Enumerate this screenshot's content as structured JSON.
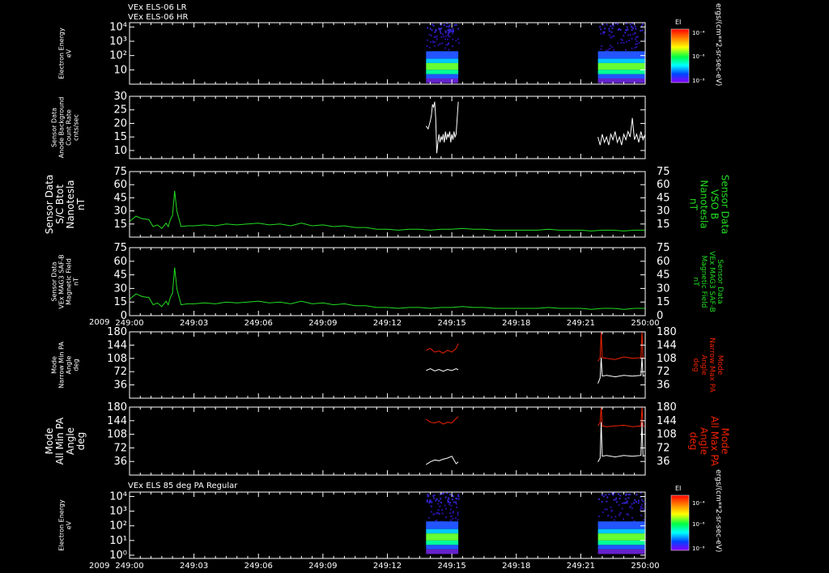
{
  "header": {
    "line1": "VEx ELS-06 LR",
    "line2": "VEx ELS-06 HR",
    "panel7_title": "VEx ELS 85 deg PA Regular"
  },
  "colors": {
    "background": "#000000",
    "axis": "#ffffff",
    "white_trace": "#ffffff",
    "green_trace": "#22dd22",
    "red_trace": "#ee2200",
    "green_label": "#22dd22",
    "red_label": "#ee2200"
  },
  "xaxis": {
    "year": "2009",
    "ticks": [
      "249:00",
      "249:03",
      "249:06",
      "249:09",
      "249:12",
      "249:15",
      "249:18",
      "249:21",
      "250:00"
    ],
    "range_hours": [
      0,
      24
    ]
  },
  "colorbar": {
    "title": "EI",
    "units": "ergs/(cm**2-sr-sec-eV)",
    "tick_labels": [
      "10⁻⁴",
      "10⁻⁶",
      "10⁻⁸"
    ]
  },
  "chart_data": [
    {
      "type": "heatmap",
      "panel": 1,
      "ylabel": [
        "Electron Energy",
        "eV"
      ],
      "yscale": "log",
      "yticks": [
        {
          "label": "10⁴",
          "value": 10000
        },
        {
          "label": "10³",
          "value": 1000
        },
        {
          "label": "10²",
          "value": 100
        },
        {
          "label": "10",
          "value": 10
        }
      ],
      "ylim": [
        1,
        20000
      ],
      "intervals_hours": [
        [
          13.8,
          15.3
        ],
        [
          21.8,
          24.0
        ]
      ]
    },
    {
      "type": "line",
      "panel": 2,
      "ylabel": [
        "Sensor Data",
        "Anode Background",
        "Count Rate",
        "cnts/sec"
      ],
      "ylim": [
        7,
        30
      ],
      "yticks": [
        10,
        15,
        20,
        25,
        30
      ],
      "series": [
        {
          "color": "#ffffff",
          "x": [
            13.8,
            13.9,
            14.0,
            14.05,
            14.1,
            14.15,
            14.2,
            14.25,
            14.3,
            14.35,
            14.4,
            14.45,
            14.5,
            14.55,
            14.6,
            14.65,
            14.7,
            14.75,
            14.8,
            14.85,
            14.9,
            14.95,
            15.0,
            15.05,
            15.1,
            15.15,
            15.2,
            15.3
          ],
          "y": [
            19,
            18,
            21,
            23,
            27,
            26,
            28,
            22,
            9,
            13,
            16,
            13,
            15,
            14,
            16,
            13,
            17,
            14,
            16,
            15,
            17,
            13,
            16,
            14,
            17,
            15,
            16,
            28
          ]
        },
        {
          "color": "#ffffff",
          "x": [
            21.8,
            21.9,
            22.0,
            22.1,
            22.2,
            22.3,
            22.4,
            22.5,
            22.6,
            22.7,
            22.8,
            22.9,
            23.0,
            23.1,
            23.2,
            23.3,
            23.4,
            23.5,
            23.6,
            23.7,
            23.8,
            23.9,
            24.0
          ],
          "y": [
            15,
            12,
            16,
            13,
            15,
            12,
            16,
            14,
            17,
            13,
            15,
            12,
            16,
            14,
            17,
            15,
            22,
            14,
            16,
            13,
            17,
            14,
            16
          ]
        }
      ]
    },
    {
      "type": "line",
      "panel": 3,
      "ylabel": [
        "Sensor Data",
        "S/C Btot",
        "Nanotesla",
        "nT"
      ],
      "ylabel_right": [
        "Sensor Data",
        "VSO B",
        "Nanotesla",
        "nT"
      ],
      "ylim": [
        0,
        75
      ],
      "yticks": [
        15,
        30,
        45,
        60,
        75
      ],
      "series": [
        {
          "color": "#22dd22",
          "x": [
            0,
            0.3,
            0.6,
            0.9,
            1.1,
            1.3,
            1.5,
            1.7,
            1.8,
            1.9,
            2.0,
            2.1,
            2.2,
            2.4,
            2.7,
            3.0,
            3.5,
            4.0,
            4.5,
            5.0,
            5.5,
            6.0,
            6.5,
            7.0,
            7.5,
            8.0,
            8.5,
            9.0,
            9.5,
            10.0,
            10.5,
            11.0,
            11.5,
            12.0,
            12.5,
            13.0,
            13.5,
            14.0,
            14.5,
            15.0,
            15.5,
            16.0,
            16.5,
            17.0,
            17.5,
            18.0,
            18.5,
            19.0,
            19.5,
            20.0,
            20.5,
            21.0,
            21.5,
            22.0,
            22.5,
            23.0,
            23.5,
            24.0
          ],
          "y": [
            18,
            24,
            21,
            20,
            12,
            14,
            10,
            16,
            12,
            20,
            25,
            53,
            30,
            12,
            13,
            13,
            14,
            13,
            15,
            14,
            15,
            16,
            14,
            15,
            13,
            16,
            13,
            14,
            12,
            13,
            11,
            11,
            9,
            9,
            8,
            9,
            9,
            8,
            9,
            9,
            10,
            9,
            9,
            8,
            8,
            8,
            8,
            8,
            9,
            8,
            8,
            8,
            7,
            8,
            8,
            7,
            8,
            8
          ]
        }
      ]
    },
    {
      "type": "line",
      "panel": 4,
      "ylabel": [
        "Sensor Data",
        "VEx MAG3 SAF-B",
        "Magnetic Field",
        "nT"
      ],
      "ylabel_right": [
        "Sensor Data",
        "VEx MAG3 SAF-B",
        "Magnetic Field",
        "nT"
      ],
      "ylim": [
        0,
        75
      ],
      "yticks": [
        0,
        15,
        30,
        45,
        60,
        75
      ],
      "series": [
        {
          "color": "#22dd22",
          "x": [
            0,
            0.3,
            0.6,
            0.9,
            1.1,
            1.3,
            1.5,
            1.7,
            1.8,
            1.9,
            2.0,
            2.1,
            2.2,
            2.4,
            2.7,
            3.0,
            3.5,
            4.0,
            4.5,
            5.0,
            5.5,
            6.0,
            6.5,
            7.0,
            7.5,
            8.0,
            8.5,
            9.0,
            9.5,
            10.0,
            10.5,
            11.0,
            11.5,
            12.0,
            12.5,
            13.0,
            13.5,
            14.0,
            14.5,
            15.0,
            15.5,
            16.0,
            16.5,
            17.0,
            17.5,
            18.0,
            18.5,
            19.0,
            19.5,
            20.0,
            20.5,
            21.0,
            21.5,
            22.0,
            22.5,
            23.0,
            23.5,
            24.0
          ],
          "y": [
            18,
            24,
            21,
            20,
            12,
            14,
            10,
            16,
            12,
            20,
            25,
            53,
            30,
            12,
            13,
            13,
            14,
            13,
            15,
            14,
            15,
            16,
            14,
            15,
            13,
            16,
            13,
            14,
            12,
            13,
            11,
            11,
            9,
            9,
            8,
            9,
            9,
            8,
            9,
            9,
            10,
            9,
            9,
            8,
            8,
            8,
            8,
            8,
            9,
            8,
            8,
            8,
            7,
            8,
            8,
            7,
            8,
            8
          ]
        }
      ]
    },
    {
      "type": "line",
      "panel": 5,
      "ylabel": [
        "Mode",
        "Narrow Min PA",
        "Angle",
        "deg"
      ],
      "ylabel_right": [
        "Mode",
        "Narrow Max PA",
        "Angle",
        "deg"
      ],
      "ylim": [
        0,
        180
      ],
      "yticks": [
        36,
        72,
        108,
        144,
        180
      ],
      "series": [
        {
          "color": "#ee2200",
          "x": [
            13.8,
            14.0,
            14.2,
            14.4,
            14.6,
            14.8,
            15.0,
            15.2,
            15.3
          ],
          "y": [
            130,
            135,
            125,
            128,
            122,
            130,
            125,
            135,
            148
          ]
        },
        {
          "color": "#ffffff",
          "x": [
            13.8,
            14.0,
            14.2,
            14.4,
            14.6,
            14.8,
            15.0,
            15.2,
            15.3
          ],
          "y": [
            75,
            80,
            74,
            78,
            73,
            78,
            75,
            80,
            77
          ]
        },
        {
          "color": "#ee2200",
          "x": [
            21.8,
            21.9,
            21.95,
            22.0,
            22.2,
            22.6,
            23.0,
            23.4,
            23.8,
            23.85,
            23.9,
            24.0
          ],
          "y": [
            100,
            110,
            180,
            110,
            108,
            105,
            112,
            108,
            110,
            180,
            110,
            108
          ]
        },
        {
          "color": "#ffffff",
          "x": [
            21.8,
            21.9,
            21.95,
            22.0,
            22.2,
            22.6,
            23.0,
            23.4,
            23.8,
            23.85,
            23.9,
            24.0
          ],
          "y": [
            40,
            55,
            110,
            60,
            62,
            58,
            62,
            60,
            62,
            110,
            60,
            62
          ]
        }
      ]
    },
    {
      "type": "line",
      "panel": 6,
      "ylabel": [
        "Mode",
        "All Min PA",
        "Angle",
        "deg"
      ],
      "ylabel_right": [
        "Mode",
        "All Max PA",
        "Angle",
        "deg"
      ],
      "ylim": [
        0,
        180
      ],
      "yticks": [
        36,
        72,
        108,
        144,
        180
      ],
      "series": [
        {
          "color": "#ee2200",
          "x": [
            13.8,
            14.0,
            14.2,
            14.4,
            14.6,
            14.8,
            15.0,
            15.2,
            15.3
          ],
          "y": [
            148,
            140,
            138,
            142,
            135,
            140,
            138,
            150,
            155
          ]
        },
        {
          "color": "#ffffff",
          "x": [
            13.8,
            14.0,
            14.2,
            14.4,
            14.6,
            14.8,
            15.0,
            15.2,
            15.3
          ],
          "y": [
            28,
            35,
            40,
            38,
            42,
            45,
            50,
            30,
            35
          ]
        },
        {
          "color": "#ee2200",
          "x": [
            21.8,
            21.9,
            21.95,
            22.0,
            22.2,
            22.6,
            23.0,
            23.4,
            23.8,
            23.85,
            23.9,
            24.0
          ],
          "y": [
            130,
            140,
            180,
            130,
            128,
            130,
            132,
            128,
            130,
            180,
            130,
            128
          ]
        },
        {
          "color": "#ffffff",
          "x": [
            21.8,
            21.9,
            21.95,
            22.0,
            22.2,
            22.6,
            23.0,
            23.4,
            23.8,
            23.85,
            23.9,
            24.0
          ],
          "y": [
            35,
            45,
            140,
            50,
            52,
            48,
            52,
            50,
            52,
            140,
            50,
            52
          ]
        }
      ]
    },
    {
      "type": "heatmap",
      "panel": 7,
      "ylabel": [
        "Electron Energy",
        "eV"
      ],
      "yscale": "log",
      "yticks": [
        {
          "label": "10⁴",
          "value": 10000
        },
        {
          "label": "10³",
          "value": 1000
        },
        {
          "label": "10²",
          "value": 100
        },
        {
          "label": "10¹",
          "value": 10
        },
        {
          "label": "10⁰",
          "value": 1
        }
      ],
      "ylim": [
        0.6,
        20000
      ],
      "intervals_hours": [
        [
          13.8,
          15.3
        ],
        [
          21.8,
          24.0
        ]
      ]
    }
  ]
}
